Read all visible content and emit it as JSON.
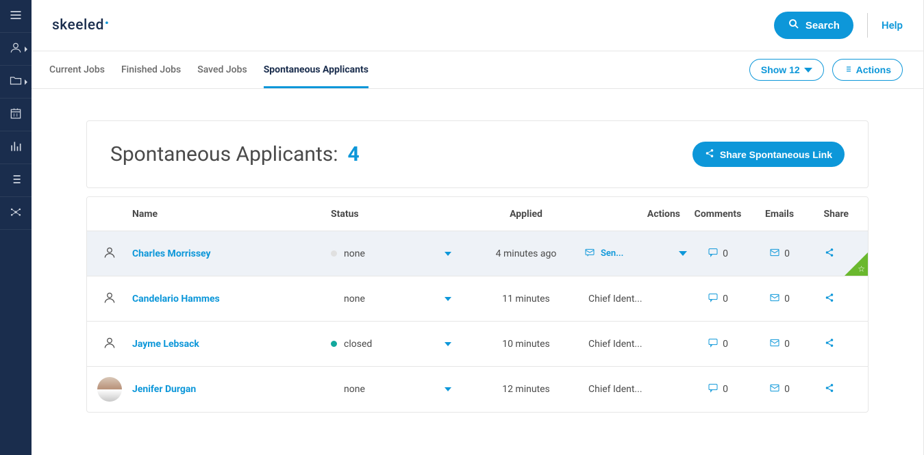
{
  "brand": "skeeled",
  "topbar": {
    "search_label": "Search",
    "help_label": "Help"
  },
  "tabs": {
    "items": [
      {
        "label": "Current Jobs",
        "active": false
      },
      {
        "label": "Finished Jobs",
        "active": false
      },
      {
        "label": "Saved Jobs",
        "active": false
      },
      {
        "label": "Spontaneous Applicants",
        "active": true
      }
    ],
    "show_label": "Show 12",
    "actions_label": "Actions"
  },
  "hero": {
    "title": "Spontaneous Applicants:",
    "count": "4",
    "share_btn": "Share Spontaneous Link"
  },
  "table": {
    "headers": {
      "name": "Name",
      "status": "Status",
      "applied": "Applied",
      "actions": "Actions",
      "comments": "Comments",
      "emails": "Emails",
      "share": "Share"
    },
    "rows": [
      {
        "name": "Charles Morrissey",
        "status": "none",
        "status_color": "grey",
        "applied": "4 minutes ago",
        "action": "Sen...",
        "action_type": "send",
        "comments": "0",
        "emails": "0",
        "highlight": true,
        "badge": true,
        "avatar": "icon"
      },
      {
        "name": "Candelario Hammes",
        "status": "none",
        "status_color": "none",
        "applied": "11 minutes",
        "action": "Chief Ident...",
        "action_type": "plain",
        "comments": "0",
        "emails": "0",
        "highlight": false,
        "badge": false,
        "avatar": "icon"
      },
      {
        "name": "Jayme Lebsack",
        "status": "closed",
        "status_color": "teal",
        "applied": "10 minutes",
        "action": "Chief Ident...",
        "action_type": "plain",
        "comments": "0",
        "emails": "0",
        "highlight": false,
        "badge": false,
        "avatar": "icon"
      },
      {
        "name": "Jenifer Durgan",
        "status": "none",
        "status_color": "none",
        "applied": "12 minutes",
        "action": "Chief Ident...",
        "action_type": "plain",
        "comments": "0",
        "emails": "0",
        "highlight": false,
        "badge": false,
        "avatar": "pic"
      }
    ]
  },
  "sidebar_icons": [
    "menu-icon",
    "user-arrow-icon",
    "folder-arrow-icon",
    "calendar-icon",
    "stats-icon",
    "list-icon",
    "network-icon"
  ]
}
